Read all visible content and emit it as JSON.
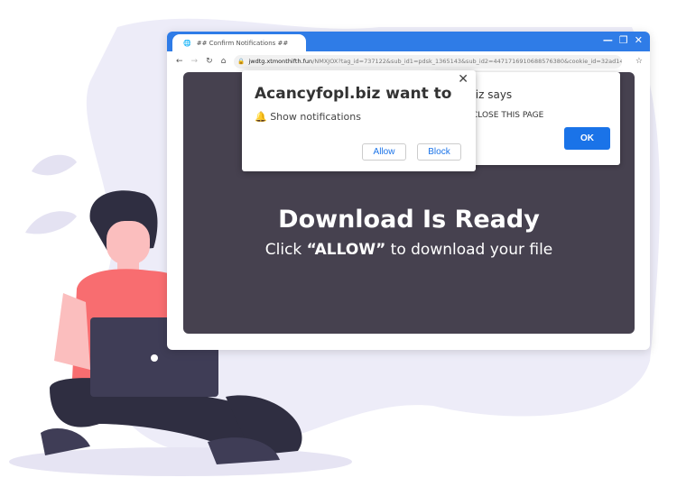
{
  "browser": {
    "tab_title": "## Confirm Notifications ##",
    "url_domain": "jwdtg.xtmonthifth.fun",
    "url_path": "/NMXJOX?tag_id=737122&sub_id1=pdsk_1365143&sub_id2=4471716910688576380&cookie_id=32ad14d4...",
    "icons": [
      "globe-icon",
      "back-icon",
      "forward-icon",
      "reload-icon",
      "home-icon",
      "lock-icon",
      "star-icon",
      "minimize-icon",
      "restore-icon",
      "close-icon"
    ]
  },
  "page": {
    "headline": "Download Is Ready",
    "subline_pre": "Click ",
    "subline_bold": "“ALLOW”",
    "subline_post": " to download your file"
  },
  "alert": {
    "title": "l.biz says",
    "message": "CLOSE THIS PAGE",
    "ok_label": "OK"
  },
  "notification": {
    "title": "Acancyfopl.biz want to",
    "message": "Show notifications",
    "allow_label": "Allow",
    "block_label": "Block"
  },
  "colors": {
    "accent": "#2f7ce7",
    "button": "#1a73e8",
    "content_bg": "#46414f"
  }
}
